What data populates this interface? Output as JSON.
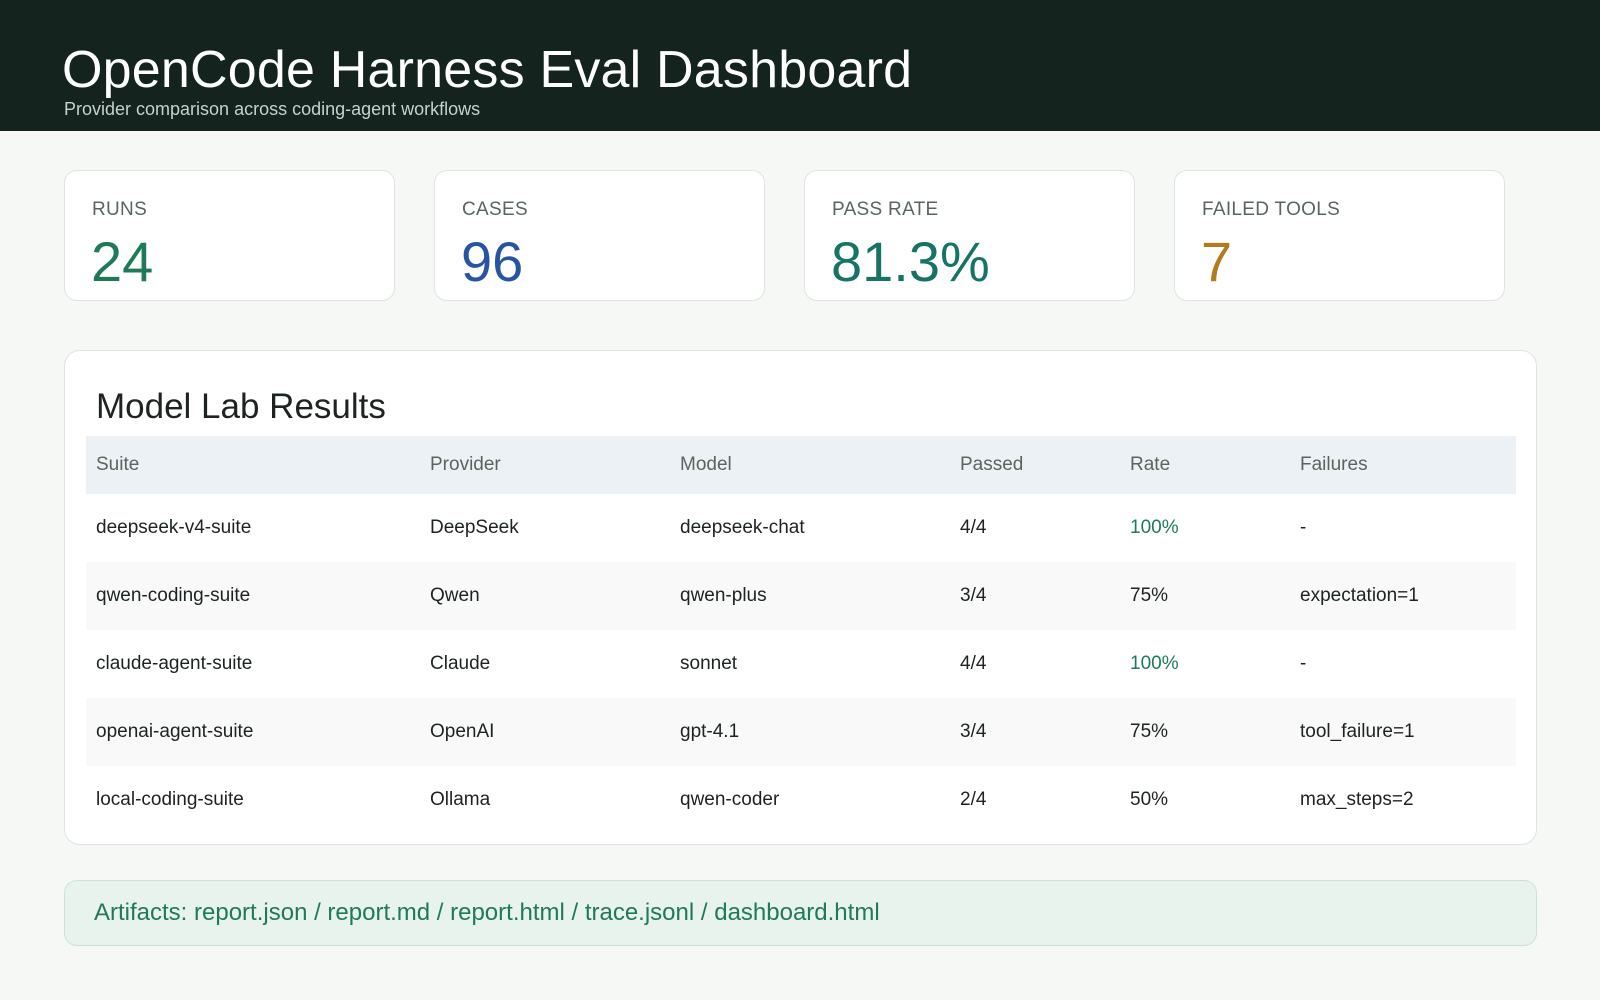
{
  "header": {
    "title": "OpenCode Harness Eval Dashboard",
    "subtitle": "Provider comparison across coding-agent workflows"
  },
  "stats": [
    {
      "label": "RUNS",
      "value": "24",
      "color": "#1f7a58"
    },
    {
      "label": "CASES",
      "value": "96",
      "color": "#2755a3"
    },
    {
      "label": "PASS RATE",
      "value": "81.3%",
      "color": "#167466"
    },
    {
      "label": "FAILED TOOLS",
      "value": "7",
      "color": "#b37a1f"
    }
  ],
  "results": {
    "title": "Model Lab Results",
    "columns": [
      "Suite",
      "Provider",
      "Model",
      "Passed",
      "Rate",
      "Failures"
    ],
    "rows": [
      {
        "suite": "deepseek-v4-suite",
        "provider": "DeepSeek",
        "model": "deepseek-chat",
        "passed": "4/4",
        "rate": "100%",
        "failures": "-"
      },
      {
        "suite": "qwen-coding-suite",
        "provider": "Qwen",
        "model": "qwen-plus",
        "passed": "3/4",
        "rate": "75%",
        "failures": "expectation=1"
      },
      {
        "suite": "claude-agent-suite",
        "provider": "Claude",
        "model": "sonnet",
        "passed": "4/4",
        "rate": "100%",
        "failures": "-"
      },
      {
        "suite": "openai-agent-suite",
        "provider": "OpenAI",
        "model": "gpt-4.1",
        "passed": "3/4",
        "rate": "75%",
        "failures": "tool_failure=1"
      },
      {
        "suite": "local-coding-suite",
        "provider": "Ollama",
        "model": "qwen-coder",
        "passed": "2/4",
        "rate": "50%",
        "failures": "max_steps=2"
      }
    ],
    "full_rate_color": "#1f7a58"
  },
  "artifacts": {
    "text": "Artifacts: report.json / report.md / report.html / trace.jsonl / dashboard.html",
    "color": "#1f7a58"
  }
}
